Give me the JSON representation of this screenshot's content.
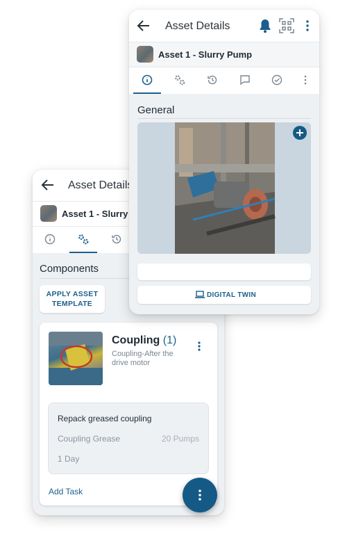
{
  "back_screen": {
    "title": "Asset Details",
    "asset_name": "Asset 1 - Slurry P",
    "section_title": "Components",
    "apply_button": "APPLY ASSET TEMPLATE",
    "component": {
      "name": "Coupling",
      "count": "(1)",
      "description": "Coupling-After the drive motor",
      "task": {
        "name": "Repack greased coupling",
        "material": "Coupling Grease",
        "quantity": "20 Pumps",
        "frequency": "1 Day"
      },
      "add_task": "Add Task"
    }
  },
  "front_screen": {
    "title": "Asset Details",
    "asset_name": "Asset 1 - Slurry Pump",
    "section_title": "General",
    "digital_twin_button": "DIGITAL TWIN"
  },
  "tabs": [
    "info-icon",
    "gears-icon",
    "history-icon",
    "comment-icon",
    "check-circle-icon",
    "more-vertical-icon"
  ],
  "colors": {
    "accent": "#1c5f8c",
    "fab": "#155a86",
    "background": "#eef1f4"
  }
}
